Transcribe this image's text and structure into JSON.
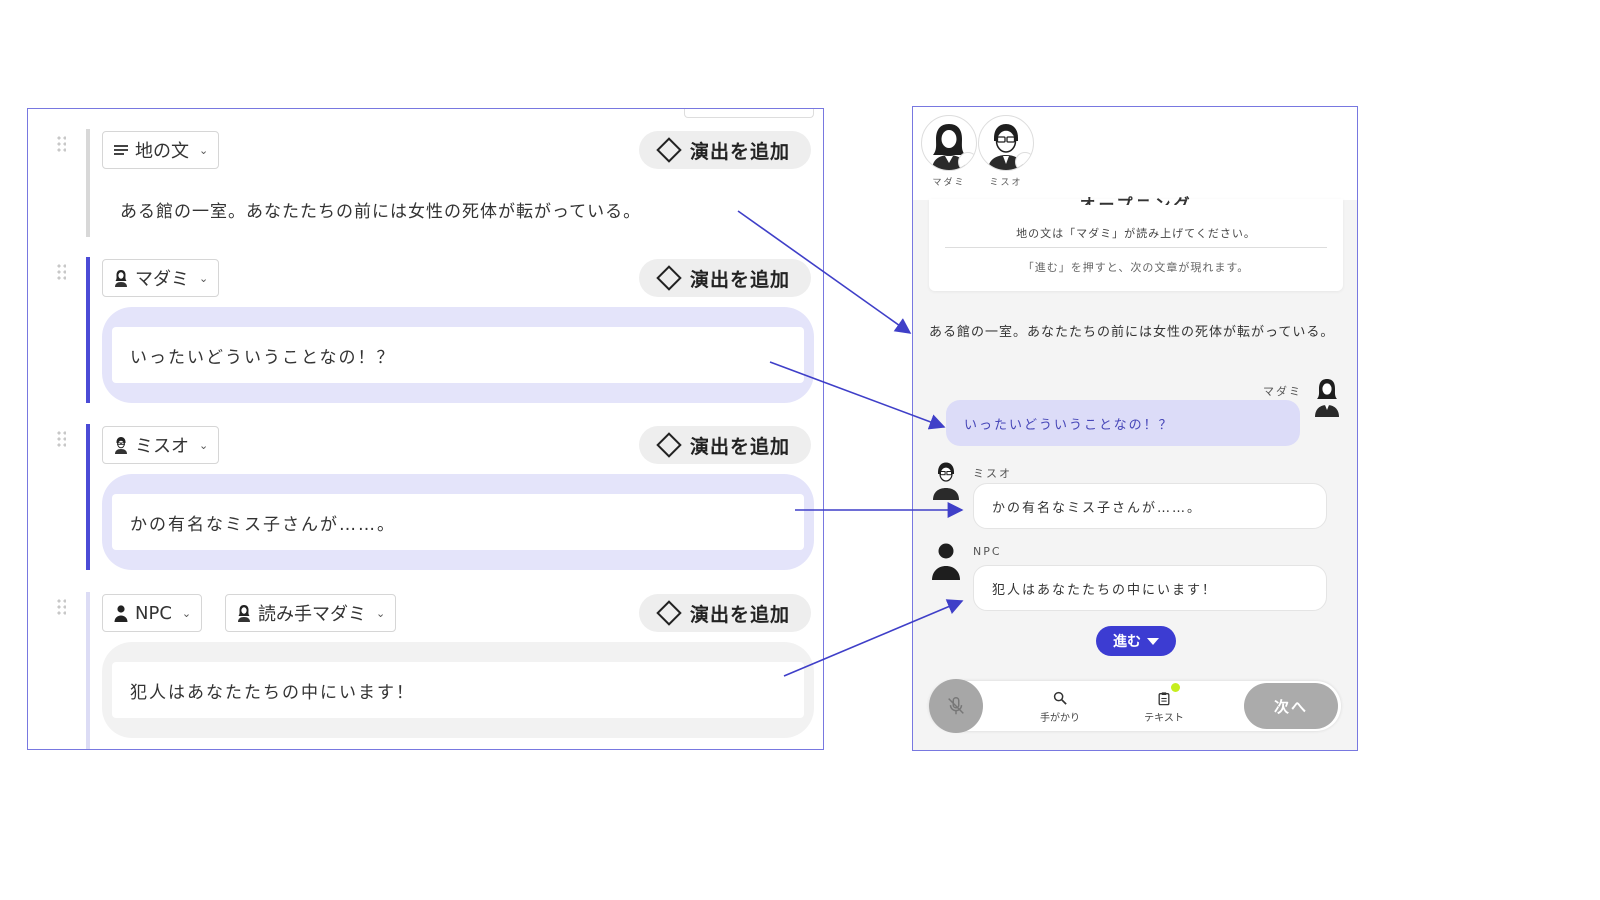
{
  "editor": {
    "effect_label": "演出を追加",
    "blocks": [
      {
        "chip": "地の文",
        "text": "ある館の一室。あなたたちの前には女性の死体が転がっている。"
      },
      {
        "chip": "マダミ",
        "text": "いったいどういうことなの！？"
      },
      {
        "chip": "ミスオ",
        "text": "かの有名なミス子さんが……。"
      },
      {
        "chip": "NPC",
        "chip2": "読み手マダミ",
        "text": "犯人はあなたたちの中にいます！"
      }
    ]
  },
  "phone": {
    "avatars": [
      {
        "name": "マダミ",
        "icon": "female-avatar-icon"
      },
      {
        "name": "ミスオ",
        "icon": "male-glasses-avatar-icon"
      }
    ],
    "opening": {
      "title": "オープニング",
      "line1": "地の文は「マダミ」が読み上げてください。",
      "line2": "「進む」を押すと、次の文章が現れます。"
    },
    "narration": "ある館の一室。あなたたちの前には女性の死体が転がっている。",
    "messages": [
      {
        "speaker": "マダミ",
        "text": "いったいどういうことなの！？",
        "side": "right"
      },
      {
        "speaker": "ミスオ",
        "text": "かの有名なミス子さんが……。",
        "side": "left"
      },
      {
        "speaker": "NPC",
        "text": "犯人はあなたたちの中にいます！",
        "side": "left"
      }
    ],
    "advance_label": "進む",
    "toolbar": {
      "clue_label": "手がかり",
      "text_label": "テキスト",
      "next_label": "次へ"
    }
  },
  "colors": {
    "accent": "#3c3cd2",
    "frame": "#7878e0",
    "self_bubble": "#dcdcf8",
    "notification_dot": "#c6ee1f"
  }
}
